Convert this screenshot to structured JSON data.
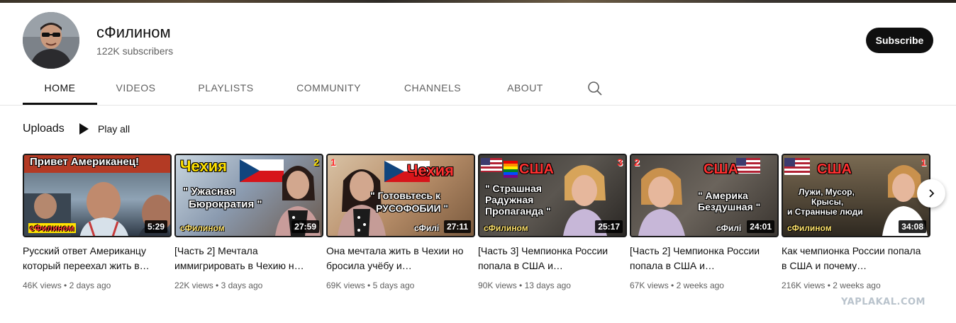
{
  "channel": {
    "name": "сФилином",
    "subscribers": "122K subscribers",
    "subscribe_label": "Subscribe"
  },
  "tabs": [
    {
      "label": "HOME",
      "active": true
    },
    {
      "label": "VIDEOS",
      "active": false
    },
    {
      "label": "PLAYLISTS",
      "active": false
    },
    {
      "label": "COMMUNITY",
      "active": false
    },
    {
      "label": "CHANNELS",
      "active": false
    },
    {
      "label": "ABOUT",
      "active": false
    }
  ],
  "uploads": {
    "title": "Uploads",
    "play_all_label": "Play all"
  },
  "videos": [
    {
      "title": "Русский ответ Американцу который переехал жить в…",
      "views": "46K views",
      "age": "2 days ago",
      "duration": "5:29",
      "thumb_text": [
        "Привет Американец!"
      ],
      "thumb_brand": "сФилином",
      "thumb_badge": ""
    },
    {
      "title": "[Часть 2] Мечтала иммигрировать в Чехию н…",
      "views": "22K views",
      "age": "3 days ago",
      "duration": "27:59",
      "thumb_text": [
        "Чехия",
        "\" Ужасная",
        "Бюрократия \""
      ],
      "thumb_brand": "сФилином",
      "thumb_badge": "2"
    },
    {
      "title": "Она мечтала жить в Чехии но бросила учёбу и…",
      "views": "69K views",
      "age": "5 days ago",
      "duration": "27:11",
      "thumb_text": [
        "Чехия",
        "\" Готовьтесь к",
        "РУСОФОБИИ \""
      ],
      "thumb_brand": "сФилі",
      "thumb_badge": "1"
    },
    {
      "title": "[Часть 3] Чемпионка России попала в США и…",
      "views": "90K views",
      "age": "13 days ago",
      "duration": "25:17",
      "thumb_text": [
        "США",
        "\" Страшная",
        "Радужная",
        "Пропаганда \""
      ],
      "thumb_brand": "сФилином",
      "thumb_badge": "3"
    },
    {
      "title": "[Часть 2] Чемпионка России попала в США и…",
      "views": "67K views",
      "age": "2 weeks ago",
      "duration": "24:01",
      "thumb_text": [
        "США",
        "\" Америка",
        "Бездушная \""
      ],
      "thumb_brand": "сФилі",
      "thumb_badge": "2"
    },
    {
      "title": "Как чемпионка России попала в США и почему…",
      "views": "216K views",
      "age": "2 weeks ago",
      "duration": "34:08",
      "thumb_text": [
        "США",
        "Лужи, Мусор,",
        "Крысы,",
        "и Странные люди"
      ],
      "thumb_brand": "сФилином",
      "thumb_badge": "1"
    }
  ],
  "meta_separator": "•",
  "watermark": "YAPLAKAL.COM",
  "icons": {
    "search": "search-icon",
    "play": "play-icon",
    "next": "chevron-right-icon"
  },
  "colors": {
    "subscribe_bg": "#0f0f0f",
    "text_secondary": "#606060",
    "tab_underline": "#0f0f0f"
  }
}
